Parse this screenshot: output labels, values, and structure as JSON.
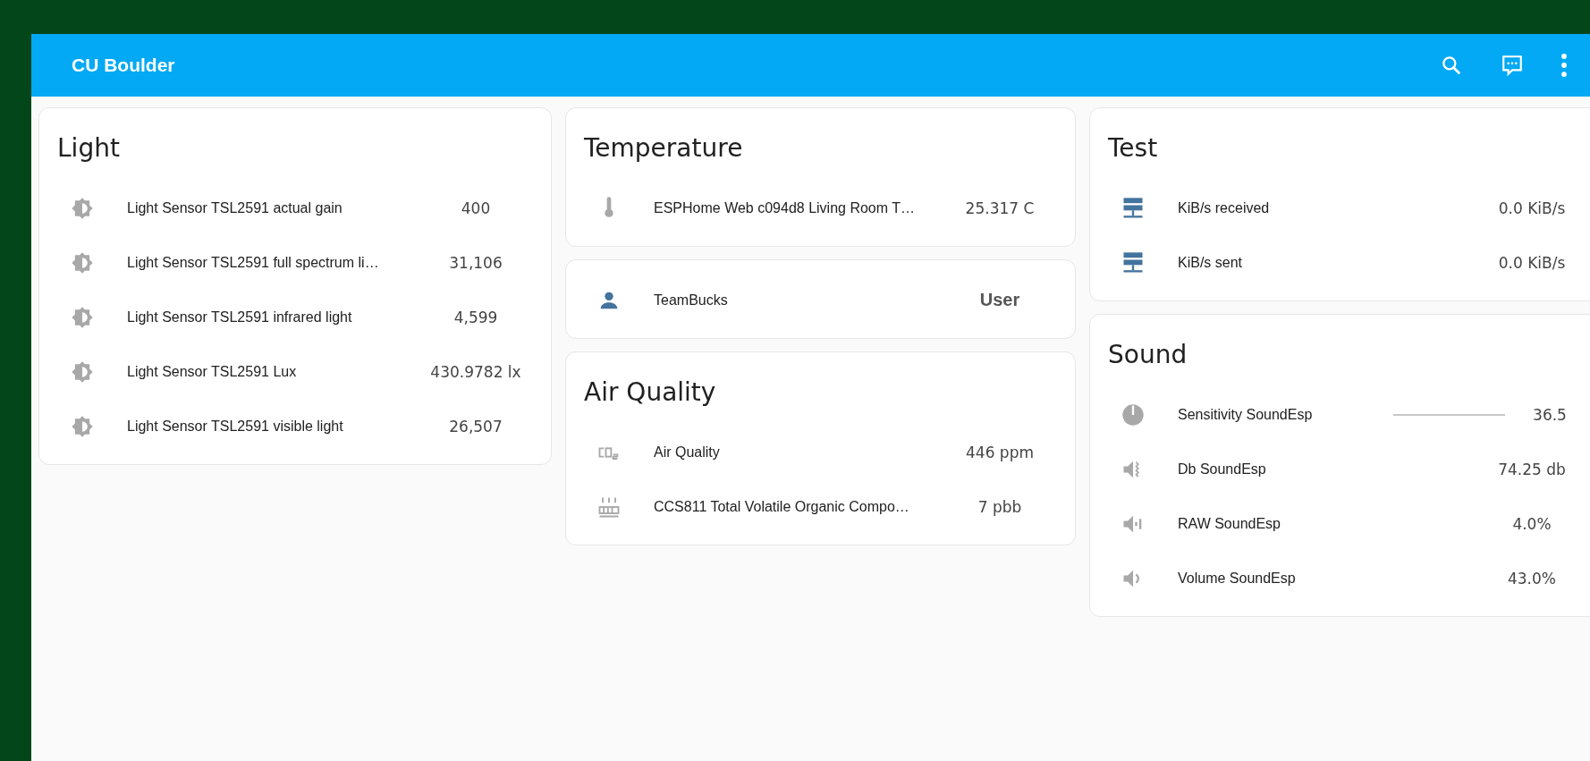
{
  "app_bar": {
    "title": "CU Boulder"
  },
  "columns": [
    [
      {
        "title": "Light",
        "entities": [
          {
            "kind": "sensor",
            "name": "Light Sensor TSL2591 actual gain",
            "value": "400"
          },
          {
            "kind": "sensor",
            "name": "Light Sensor TSL2591 full spectrum li…",
            "value": "31,106"
          },
          {
            "kind": "sensor",
            "name": "Light Sensor TSL2591 infrared light",
            "value": "4,599"
          },
          {
            "kind": "sensor",
            "name": "Light Sensor TSL2591 Lux",
            "value": "430.9782 lx"
          },
          {
            "kind": "sensor",
            "name": "Light Sensor TSL2591 visible light",
            "value": "26,507"
          }
        ]
      }
    ],
    [
      {
        "title": "Temperature",
        "entities": [
          {
            "kind": "sensor",
            "name": "ESPHome Web c094d8 Living Room T…",
            "value": "25.317 C"
          }
        ]
      },
      {
        "entities": [
          {
            "kind": "user",
            "name": "TeamBucks",
            "value": "User"
          }
        ]
      },
      {
        "title": "Air Quality",
        "entities": [
          {
            "kind": "sensor",
            "name": "Air Quality",
            "value": "446 ppm"
          },
          {
            "kind": "sensor",
            "name": "CCS811 Total Volatile Organic Compo…",
            "value": "7 pbb"
          }
        ]
      }
    ],
    [
      {
        "title": "Test",
        "entities": [
          {
            "kind": "sensor",
            "name": "KiB/s received",
            "value": "0.0 KiB/s"
          },
          {
            "kind": "sensor",
            "name": "KiB/s sent",
            "value": "0.0 KiB/s"
          }
        ]
      },
      {
        "title": "Sound",
        "entities": [
          {
            "kind": "slider",
            "name": "Sensitivity SoundEsp",
            "value": "36.5"
          },
          {
            "kind": "sensor",
            "name": "Db SoundEsp",
            "value": "74.25 db"
          },
          {
            "kind": "sensor",
            "name": "RAW SoundEsp",
            "value": "4.0%"
          },
          {
            "kind": "sensor",
            "name": "Volume SoundEsp",
            "value": "43.0%"
          }
        ]
      }
    ]
  ]
}
